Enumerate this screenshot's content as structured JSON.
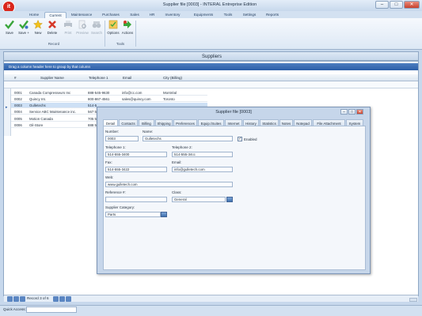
{
  "app": {
    "logo_text": "it",
    "title": "Supplier file [0003] - INTERAL Entreprise Edition"
  },
  "menu": [
    "Home",
    "Current",
    "Maintenance",
    "Purchases",
    "Sales",
    "HR",
    "Inventory",
    "Equipments",
    "Tools",
    "Settings",
    "Reports"
  ],
  "ribbon": {
    "buttons": [
      "Save",
      "Save +",
      "New",
      "Delete",
      "Print",
      "Preview",
      "Search",
      "Options",
      "Actions"
    ],
    "groups": [
      "Record",
      "Tools"
    ]
  },
  "colors": {
    "accent": "#2b5ea8",
    "brand": "#d9261c"
  },
  "suppliers": {
    "title": "Suppliers",
    "group_hint": "Drag a column header here to group by that column",
    "columns": [
      "#",
      "Supplier Name",
      "Telephone 1",
      "Email",
      "City (Billing)"
    ],
    "rows": [
      [
        "0001",
        "Canada Compresseurs Inc",
        "888-545-9630",
        "info@cc.com",
        "Montréal"
      ],
      [
        "0002",
        "Quincy Int.",
        "800-867-4561",
        "sales@quincy.com",
        "Toronto"
      ],
      [
        "0003",
        "Gulletechs",
        "514-5",
        "",
        " "
      ],
      [
        "0004",
        "Service ABC Maintenance inc.",
        "567 5",
        "",
        ""
      ],
      [
        "0005",
        "Motion Canada",
        "705 5",
        "",
        ""
      ],
      [
        "0006",
        "Oil-Store",
        "888 5",
        "",
        ""
      ]
    ],
    "selected_row_marker": "▸",
    "record_text": "Record 3 of 6",
    "quick_access_label": "Quick Access:"
  },
  "dialog": {
    "title": "Supplier file [0003]",
    "tabs": [
      "Detail",
      "Contacts",
      "Billing",
      "Shipping",
      "Preferences",
      "Equip./Suites",
      "Internet",
      "History",
      "Statistics",
      "Notes",
      "Notepad",
      "File Attachment",
      "System"
    ],
    "number_label": "Number:",
    "number_value": "0003",
    "name_label": "Name:",
    "name_value": "Gulletechs",
    "enabled_label": "Enabled",
    "enabled_check": "✓",
    "tel1_label": "Telephone 1:",
    "tel1_value": "514-555-3400",
    "tel2_label": "Telephone 2:",
    "tel2_value": "514-555-34cc",
    "fax_label": "Fax:",
    "fax_value": "514-555-3422",
    "email_label": "Email:",
    "email_value": "info@gulletech.com",
    "web_label": "Web:",
    "web_value": "www.gulletech.com",
    "ref_label": "Reference #:",
    "ref_value": "",
    "class_label": "Class:",
    "class_value": "General",
    "category_label": "Supplier Category:",
    "category_value": "Parts"
  }
}
